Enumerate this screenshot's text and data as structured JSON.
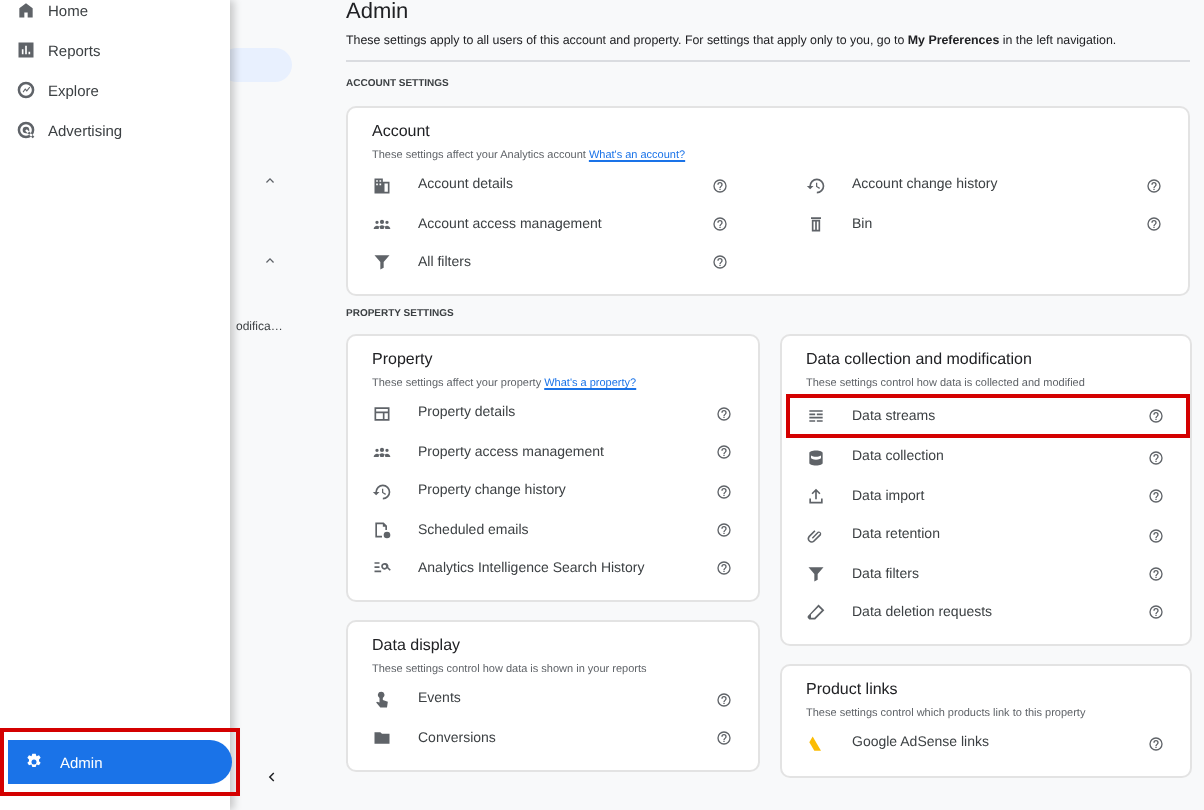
{
  "nav": {
    "items": [
      {
        "label": "Home",
        "kind": "home",
        "selected": false
      },
      {
        "label": "Reports",
        "kind": "bar-chart",
        "selected": false
      },
      {
        "label": "Explore",
        "kind": "gauge",
        "selected": false
      },
      {
        "label": "Advertising",
        "kind": "target",
        "selected": false
      }
    ],
    "admin": {
      "label": "Admin",
      "kind": "gear",
      "selected": true,
      "highlighted": true
    }
  },
  "background_panel": {
    "text": "odifica…"
  },
  "main": {
    "title": "Admin",
    "intro": "These settings apply to all users of this account and property. For settings that apply only to you, go to **My Preferences** in the left navigation.",
    "account_section": {
      "heading": "ACCOUNT SETTINGS",
      "card": {
        "title": "Account",
        "description": "These settings affect your Analytics account",
        "link": "What's an account?",
        "items": [
          {
            "label": "Account details",
            "kind": "building",
            "highlighted": false
          },
          {
            "label": "Account change history",
            "kind": "history",
            "highlighted": false
          },
          {
            "label": "Account access management",
            "kind": "people",
            "highlighted": false
          },
          {
            "label": "Bin",
            "kind": "bin",
            "highlighted": false
          },
          {
            "label": "All filters",
            "kind": "filter",
            "highlighted": false
          }
        ]
      }
    },
    "property_section": {
      "heading": "PROPERTY SETTINGS",
      "columns": [
        [
          {
            "title": "Property",
            "description": "These settings affect your property",
            "link": "What's a property?",
            "items": [
              {
                "label": "Property details",
                "kind": "window",
                "highlighted": false
              },
              {
                "label": "Property access management",
                "kind": "people",
                "highlighted": false
              },
              {
                "label": "Property change history",
                "kind": "history",
                "highlighted": false
              },
              {
                "label": "Scheduled emails",
                "kind": "document-clock",
                "highlighted": false
              },
              {
                "label": "Analytics Intelligence Search History",
                "kind": "search-list",
                "highlighted": false
              }
            ]
          },
          {
            "title": "Data display",
            "description": "These settings control how data is shown in your reports",
            "items": [
              {
                "label": "Events",
                "kind": "touch",
                "highlighted": false
              },
              {
                "label": "Conversions",
                "kind": "folder",
                "highlighted": false
              }
            ]
          }
        ],
        [
          {
            "title": "Data collection and modification",
            "description": "These settings control how data is collected and modified",
            "items": [
              {
                "label": "Data streams",
                "kind": "stream",
                "highlighted": true
              },
              {
                "label": "Data collection",
                "kind": "database",
                "highlighted": false
              },
              {
                "label": "Data import",
                "kind": "upload",
                "highlighted": false
              },
              {
                "label": "Data retention",
                "kind": "paperclip",
                "highlighted": false
              },
              {
                "label": "Data filters",
                "kind": "filter",
                "highlighted": false
              },
              {
                "label": "Data deletion requests",
                "kind": "eraser",
                "highlighted": false
              }
            ]
          },
          {
            "title": "Product links",
            "description": "These settings control which products link to this property",
            "items": [
              {
                "label": "Google AdSense links",
                "kind": "logo",
                "highlighted": false
              }
            ]
          }
        ]
      ]
    }
  }
}
